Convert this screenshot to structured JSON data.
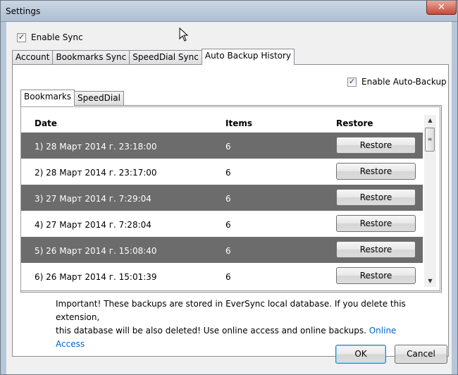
{
  "window": {
    "title": "Settings",
    "close_label": "✕"
  },
  "enable_sync": {
    "label": "Enable Sync",
    "checked": true
  },
  "tabs": [
    {
      "label": "Account"
    },
    {
      "label": "Bookmarks Sync"
    },
    {
      "label": "SpeedDial Sync"
    },
    {
      "label": "Auto Backup History"
    }
  ],
  "active_tab": "Auto Backup History",
  "enable_auto_backup": {
    "label": "Enable Auto-Backup",
    "checked": true
  },
  "sub_tabs": [
    {
      "label": "Bookmarks"
    },
    {
      "label": "SpeedDial"
    }
  ],
  "table": {
    "columns": {
      "date": "Date",
      "items": "Items",
      "restore": "Restore"
    },
    "rows": [
      {
        "date": "1) 28 Март 2014 г. 23:18:00",
        "items": "6",
        "action": "Restore"
      },
      {
        "date": "2) 28 Март 2014 г. 23:17:00",
        "items": "6",
        "action": "Restore"
      },
      {
        "date": "3) 27 Март 2014 г. 7:29:04",
        "items": "6",
        "action": "Restore"
      },
      {
        "date": "4) 27 Март 2014 г. 7:28:04",
        "items": "6",
        "action": "Restore"
      },
      {
        "date": "5) 26 Март 2014 г. 15:08:40",
        "items": "6",
        "action": "Restore"
      },
      {
        "date": "6) 26 Март 2014 г. 15:01:39",
        "items": "6",
        "action": "Restore"
      }
    ]
  },
  "notice": {
    "line1": "Important! These backups are stored in EverSync local database. If you delete this extension,",
    "line2": "this database will be also deleted! Use online access and online backups.",
    "link": "Online Access"
  },
  "buttons": {
    "ok": "OK",
    "cancel": "Cancel"
  },
  "colors": {
    "dark_row": "#6c6c6c",
    "link": "#0066cc"
  }
}
